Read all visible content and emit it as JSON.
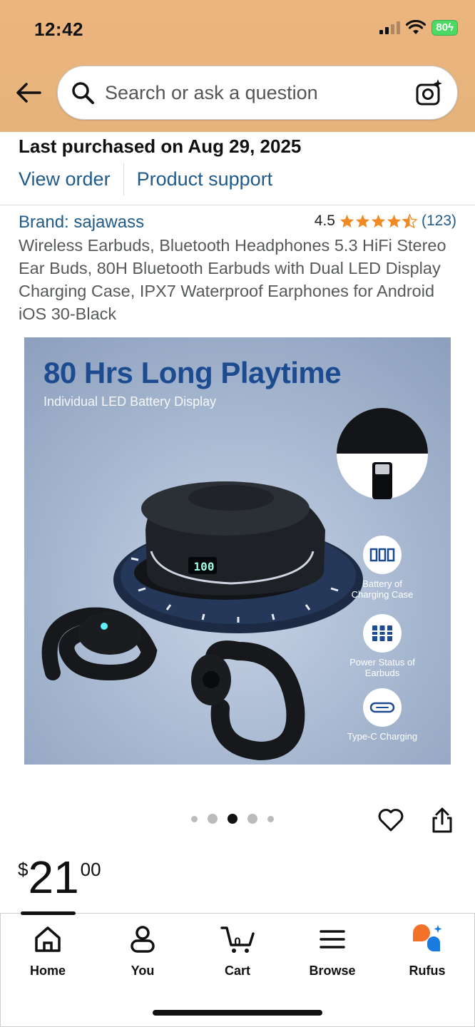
{
  "status_bar": {
    "time": "12:42",
    "battery": "80"
  },
  "search": {
    "placeholder": "Search or ask a question"
  },
  "purchase": {
    "text": "Last purchased on Aug 29, 2025",
    "view_order": "View order",
    "product_support": "Product support"
  },
  "product": {
    "brand": "Brand: sajawass",
    "rating": "4.5",
    "rating_stars": 4.5,
    "review_count": "(123)",
    "title": "Wireless Earbuds, Bluetooth Headphones 5.3 HiFi Stereo Ear Buds, 80H Bluetooth Earbuds with Dual LED Display Charging Case, IPX7 Waterproof Earphones for Android iOS 30-Black"
  },
  "image": {
    "headline": "80 Hrs Long Playtime",
    "subtitle": "Individual LED Battery Display",
    "led_readout": "100",
    "features": [
      {
        "label": "Battery of Charging Case",
        "icon": "digital-display-icon"
      },
      {
        "label": "Power Status of Earbuds",
        "icon": "battery-bars-icon"
      },
      {
        "label": "Type-C Charging",
        "icon": "usb-c-port-icon"
      }
    ]
  },
  "carousel": {
    "total": 5,
    "active_index": 2
  },
  "price": {
    "symbol": "$",
    "whole": "21",
    "fraction": "00"
  },
  "tabbar": {
    "active": "Home",
    "cart_count": "0",
    "tabs": [
      {
        "label": "Home",
        "icon": "home-icon"
      },
      {
        "label": "You",
        "icon": "person-icon"
      },
      {
        "label": "Cart",
        "icon": "cart-icon"
      },
      {
        "label": "Browse",
        "icon": "menu-icon"
      },
      {
        "label": "Rufus",
        "icon": "rufus-icon"
      }
    ]
  },
  "colors": {
    "header": "#e6b37c",
    "link": "#1f5a8a",
    "star": "#f08a24",
    "battery": "#4cd964"
  }
}
